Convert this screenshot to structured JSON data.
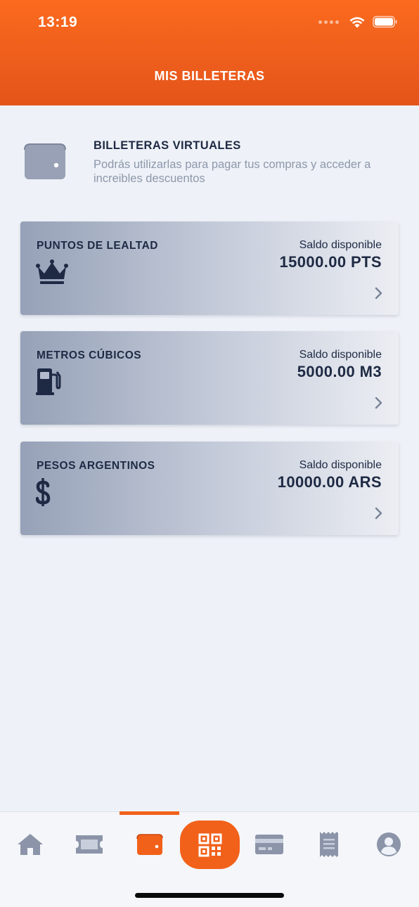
{
  "status_bar": {
    "time": "13:19"
  },
  "header": {
    "title": "MIS BILLETERAS"
  },
  "intro": {
    "title": "BILLETERAS VIRTUALES",
    "description": "Podrás utilizarlas para pagar tus compras y acceder a increibles descuentos",
    "icon": "wallet-icon"
  },
  "wallets": [
    {
      "label": "PUNTOS DE LEALTAD",
      "icon": "crown-icon",
      "balance_label": "Saldo disponible",
      "balance": "15000.00 PTS"
    },
    {
      "label": "METROS CÚBICOS",
      "icon": "gas-pump-icon",
      "balance_label": "Saldo disponible",
      "balance": "5000.00 M3"
    },
    {
      "label": "PESOS ARGENTINOS",
      "icon": "dollar-icon",
      "balance_label": "Saldo disponible",
      "balance": "10000.00 ARS"
    }
  ],
  "bottom_nav": {
    "items": [
      "home-icon",
      "ticket-icon",
      "wallet-icon",
      "qr-code-icon",
      "credit-card-icon",
      "receipt-icon",
      "user-icon"
    ],
    "active": "wallet-icon"
  },
  "colors": {
    "brand": "#f2611a",
    "icon_gray": "#8b94a8",
    "text_dark": "#1e2a44"
  }
}
